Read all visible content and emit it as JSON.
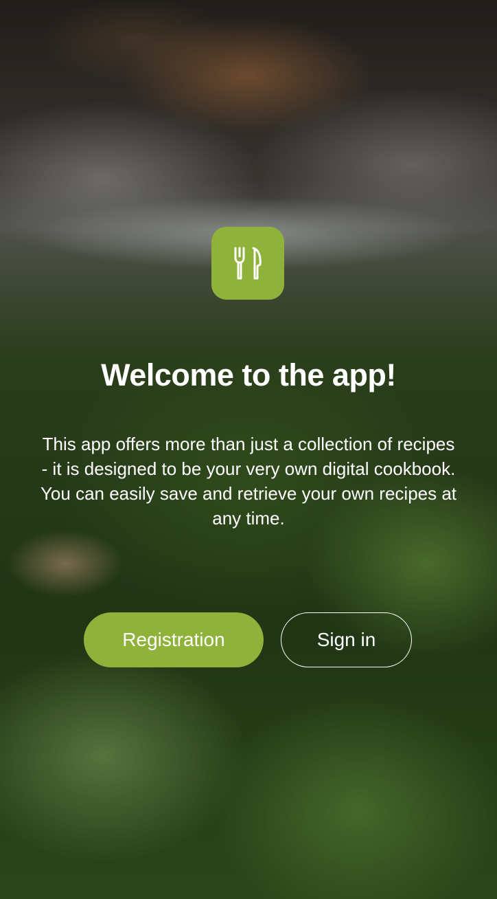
{
  "welcome": {
    "logo_icon": "fork-knife-icon",
    "title": "Welcome to the app!",
    "description": "This app offers more than just a collection of recipes - it is designed to be your very own digital cookbook. You can easily save and retrieve your own recipes at any time.",
    "register_label": "Registration",
    "signin_label": "Sign in"
  },
  "colors": {
    "accent": "#8fb33a",
    "text": "#ffffff"
  }
}
